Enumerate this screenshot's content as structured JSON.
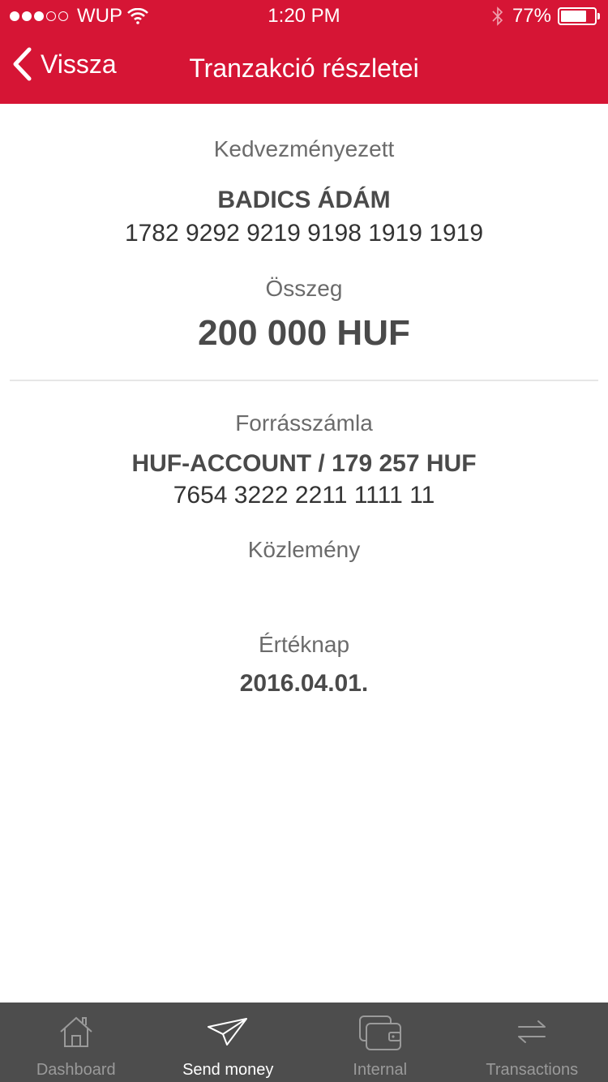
{
  "status": {
    "carrier": "WUP",
    "time": "1:20 PM",
    "battery": "77%",
    "battery_level": 0.77,
    "signal_bars_full": 3,
    "signal_bars_total": 5
  },
  "nav": {
    "back_label": "Vissza",
    "title": "Tranzakció részletei"
  },
  "beneficiary": {
    "label": "Kedvezményezett",
    "name": "BADICS ÁDÁM",
    "account": "1782 9292 9219 9198 1919 1919"
  },
  "amount": {
    "label": "Összeg",
    "value": "200 000 HUF"
  },
  "source": {
    "label": "Forrásszámla",
    "name": "HUF-ACCOUNT / 179 257 HUF",
    "account": "7654 3222 2211 1111 11"
  },
  "note": {
    "label": "Közlemény",
    "value": ""
  },
  "value_date": {
    "label": "Értéknap",
    "value": "2016.04.01."
  },
  "tabs": [
    {
      "label": "Dashboard",
      "icon": "home-icon",
      "active": false
    },
    {
      "label": "Send money",
      "icon": "paper-plane-icon",
      "active": true
    },
    {
      "label": "Internal",
      "icon": "wallet-icon",
      "active": false
    },
    {
      "label": "Transactions",
      "icon": "transfer-arrows-icon",
      "active": false
    }
  ],
  "colors": {
    "brand": "#d61535",
    "tabbar_bg": "#4d4d4d"
  }
}
